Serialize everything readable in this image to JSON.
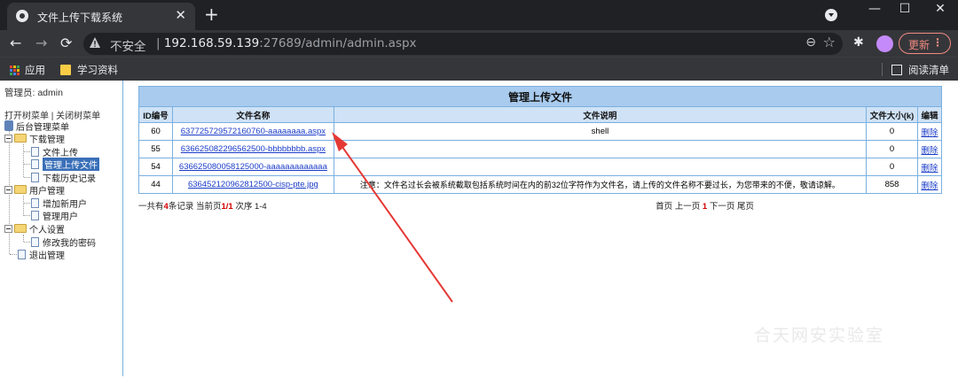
{
  "browser": {
    "tab_title": "文件上传下载系统",
    "tab_close": "✕",
    "new_tab": "+",
    "window_buttons": [
      "—",
      "☐",
      "✕"
    ],
    "insecure_label": "不安全",
    "url_host": "192.168.59.139",
    "url_port_path": ":27689/admin/admin.aspx",
    "update_label": "更新",
    "bookmarks": [
      {
        "label": "应用",
        "icon": "apps-grid-icon"
      },
      {
        "label": "学习资料",
        "icon": "folder-icon"
      }
    ],
    "reading_list": "阅读清单",
    "icons": {
      "back": "←",
      "forward": "→",
      "reload": "⟳",
      "zoom": "⊖",
      "star": "☆",
      "extensions": "✱",
      "menu": "⋮"
    }
  },
  "sidebar": {
    "admin_label": "管理员: admin",
    "open_tree": "打开树菜单",
    "divider": "|",
    "close_tree": "关闭树菜单",
    "root": "后台管理菜单",
    "groups": [
      {
        "label": "下载管理",
        "items": [
          "文件上传",
          "管理上传文件",
          "下载历史记录"
        ]
      },
      {
        "label": "用户管理",
        "items": [
          "增加新用户",
          "管理用户"
        ]
      },
      {
        "label": "个人设置",
        "items": [
          "修改我的密码"
        ]
      }
    ],
    "logout": "退出管理",
    "selected_item": "管理上传文件"
  },
  "table": {
    "caption": "管理上传文件",
    "headers": [
      "ID编号",
      "文件名称",
      "文件说明",
      "文件大小(k)",
      "编辑"
    ],
    "rows": [
      {
        "id": "60",
        "name": "637725729572160760-aaaaaaaa.aspx",
        "desc": "shell",
        "size": "0",
        "action": "删除"
      },
      {
        "id": "55",
        "name": "636625082296562500-bbbbbbbb.aspx",
        "desc": "",
        "size": "0",
        "action": "删除"
      },
      {
        "id": "54",
        "name": "636625080058125000-aaaaaaaaaaaaa",
        "desc": "",
        "size": "0",
        "action": "删除"
      },
      {
        "id": "44",
        "name": "636452120962812500-cisp-pte.jpg",
        "desc": "注意：文件名过长会被系统截取包括系统时间在内的前32位字符作为文件名，请上传的文件名称不要过长，为您带来的不便，敬请谅解。",
        "size": "858",
        "action": "删除"
      }
    ]
  },
  "pager": {
    "prefix": "一共有",
    "total": "4",
    "records": "条记录 当前页",
    "page": "1/1",
    "order": "次序 1-4",
    "first": "首页",
    "prev": "上一页",
    "current": "1",
    "next": "下一页",
    "last": "尾页"
  },
  "annotation": {
    "color": "#e53935"
  },
  "watermark": "合天网安实验室"
}
